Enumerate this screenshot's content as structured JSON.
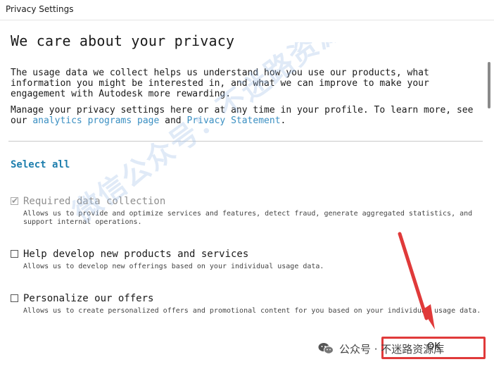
{
  "window": {
    "title": "Privacy Settings"
  },
  "heading": "We care about your privacy",
  "intro": {
    "paragraph1": "The usage data we collect helps us understand how you use our products, what information you might be interested in, and what we can improve to make your engagement with Autodesk more rewarding.",
    "paragraph2_prefix": "Manage your privacy settings here or at any time in your profile. To learn more, see our ",
    "link1": "analytics programs page",
    "paragraph2_mid": " and ",
    "link2": "Privacy Statement",
    "paragraph2_suffix": "."
  },
  "select_all": "Select all",
  "options": [
    {
      "label": "Required data collection",
      "description": "Allows us to provide and optimize services and features, detect fraud, generate aggregated statistics, and support internal operations.",
      "checked": true,
      "disabled": true
    },
    {
      "label": "Help develop new products and services",
      "description": "Allows us to develop new offerings based on your individual usage data.",
      "checked": false,
      "disabled": false
    },
    {
      "label": "Personalize our offers",
      "description": "Allows us to create personalized offers and promotional content for you based on your individual usage data.",
      "checked": false,
      "disabled": false
    }
  ],
  "ok_button": "OK",
  "watermark": "微信公众号：不迷路资源库",
  "footer": {
    "brand_text": "公众号 · 不迷路资源库"
  },
  "colors": {
    "link": "#3a8fc2",
    "select_all": "#1f7fae",
    "highlight": "#e03a3a"
  },
  "icons": {
    "wechat": "wechat-icon",
    "checkmark": "checkmark-icon"
  }
}
